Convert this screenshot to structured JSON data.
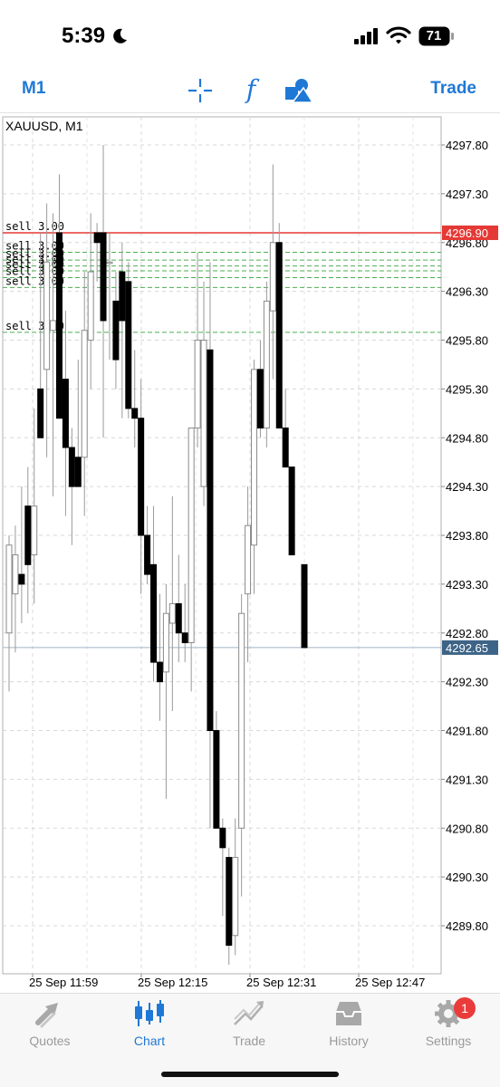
{
  "status_bar": {
    "time": "5:39",
    "battery": "71",
    "icons": [
      "moon-icon",
      "signal-icon",
      "wifi-icon",
      "battery-icon"
    ]
  },
  "toolbar": {
    "period_label": "M1",
    "trade_label": "Trade",
    "icons": [
      "crosshair-icon",
      "function-icon",
      "objects-icon"
    ],
    "function_glyph": "f",
    "accent_color": "#1f78d6"
  },
  "chart": {
    "symbol_label": "XAUUSD, M1",
    "price_labels": [
      "4297.80",
      "4297.30",
      "4296.80",
      "4296.30",
      "4295.80",
      "4295.30",
      "4294.80",
      "4294.30",
      "4293.80",
      "4293.30",
      "4292.80",
      "4292.30",
      "4291.80",
      "4291.30",
      "4290.80",
      "4290.30",
      "4289.80"
    ],
    "time_labels": [
      "25 Sep 11:59",
      "25 Sep 12:15",
      "25 Sep 12:31",
      "25 Sep 12:47"
    ],
    "sell_price_tag": "4296.90",
    "bid_price_tag": "4292.65",
    "sell_line_color": "#e53935",
    "bid_line_color": "#3d6487",
    "order_lines": [
      {
        "label": "sell 3.00",
        "price": 4296.9
      },
      {
        "label": "sell 3.00",
        "price": 4296.7
      },
      {
        "label": "sell 3.00",
        "price": 4296.62
      },
      {
        "label": "sell 3.00",
        "price": 4296.56
      },
      {
        "label": "sell 3.00",
        "price": 4296.51
      },
      {
        "label": "sell 3.00",
        "price": 4296.44
      },
      {
        "label": "sell 3.00",
        "price": 4296.34
      },
      {
        "label": "sell 3.00",
        "price": 4295.88
      }
    ]
  },
  "chart_data": {
    "type": "candlestick",
    "title": "XAUUSD, M1",
    "ylim": [
      4289.4,
      4298.2
    ],
    "grid": true,
    "candles": [
      {
        "o": 4292.8,
        "h": 4293.8,
        "l": 4292.2,
        "c": 4293.7
      },
      {
        "o": 4293.2,
        "h": 4293.9,
        "l": 4292.6,
        "c": 4293.6
      },
      {
        "o": 4293.4,
        "h": 4294.3,
        "l": 4292.9,
        "c": 4293.3
      },
      {
        "o": 4294.1,
        "h": 4294.5,
        "l": 4293.0,
        "c": 4293.5
      },
      {
        "o": 4293.6,
        "h": 4295.1,
        "l": 4293.1,
        "c": 4294.1
      },
      {
        "o": 4295.3,
        "h": 4296.9,
        "l": 4294.9,
        "c": 4294.8
      },
      {
        "o": 4295.5,
        "h": 4297.2,
        "l": 4294.6,
        "c": 4296.6
      },
      {
        "o": 4295.9,
        "h": 4297.1,
        "l": 4294.2,
        "c": 4296.0
      },
      {
        "o": 4296.9,
        "h": 4297.5,
        "l": 4295.0,
        "c": 4295.0
      },
      {
        "o": 4295.4,
        "h": 4296.1,
        "l": 4294.0,
        "c": 4294.7
      },
      {
        "o": 4294.7,
        "h": 4294.9,
        "l": 4293.7,
        "c": 4294.3
      },
      {
        "o": 4294.6,
        "h": 4295.6,
        "l": 4294.3,
        "c": 4294.3
      },
      {
        "o": 4294.6,
        "h": 4296.5,
        "l": 4294.0,
        "c": 4295.9
      },
      {
        "o": 4295.8,
        "h": 4297.1,
        "l": 4295.3,
        "c": 4296.5
      },
      {
        "o": 4296.9,
        "h": 4297.0,
        "l": 4296.4,
        "c": 4296.8
      },
      {
        "o": 4296.9,
        "h": 4297.8,
        "l": 4294.8,
        "c": 4296.0
      },
      {
        "o": 4296.6,
        "h": 4296.9,
        "l": 4295.6,
        "c": 4296.6
      },
      {
        "o": 4296.2,
        "h": 4296.5,
        "l": 4295.3,
        "c": 4295.6
      },
      {
        "o": 4296.5,
        "h": 4296.8,
        "l": 4295.0,
        "c": 4296.0
      },
      {
        "o": 4296.4,
        "h": 4296.6,
        "l": 4295.0,
        "c": 4295.1
      },
      {
        "o": 4295.1,
        "h": 4295.7,
        "l": 4294.7,
        "c": 4295.0
      },
      {
        "o": 4295.0,
        "h": 4295.4,
        "l": 4293.2,
        "c": 4293.8
      },
      {
        "o": 4293.8,
        "h": 4294.1,
        "l": 4293.3,
        "c": 4293.4
      },
      {
        "o": 4293.5,
        "h": 4294.1,
        "l": 4292.3,
        "c": 4292.5
      },
      {
        "o": 4292.5,
        "h": 4293.2,
        "l": 4291.9,
        "c": 4292.3
      },
      {
        "o": 4292.4,
        "h": 4293.3,
        "l": 4291.1,
        "c": 4293.0
      },
      {
        "o": 4292.9,
        "h": 4294.2,
        "l": 4292.0,
        "c": 4293.1
      },
      {
        "o": 4293.1,
        "h": 4293.6,
        "l": 4292.5,
        "c": 4292.8
      },
      {
        "o": 4292.8,
        "h": 4293.3,
        "l": 4292.5,
        "c": 4292.7
      },
      {
        "o": 4292.7,
        "h": 4294.7,
        "l": 4292.2,
        "c": 4294.9
      },
      {
        "o": 4294.9,
        "h": 4296.7,
        "l": 4294.7,
        "c": 4295.8
      },
      {
        "o": 4294.3,
        "h": 4296.4,
        "l": 4294.1,
        "c": 4295.8
      },
      {
        "o": 4295.7,
        "h": 4296.6,
        "l": 4290.8,
        "c": 4291.8
      },
      {
        "o": 4291.8,
        "h": 4292.0,
        "l": 4290.8,
        "c": 4290.8
      },
      {
        "o": 4290.8,
        "h": 4290.9,
        "l": 4289.9,
        "c": 4290.6
      },
      {
        "o": 4290.5,
        "h": 4290.6,
        "l": 4289.4,
        "c": 4289.6
      },
      {
        "o": 4289.7,
        "h": 4290.9,
        "l": 4289.5,
        "c": 4290.5
      },
      {
        "o": 4290.8,
        "h": 4293.2,
        "l": 4290.1,
        "c": 4293.0
      },
      {
        "o": 4293.2,
        "h": 4294.3,
        "l": 4292.5,
        "c": 4293.9
      },
      {
        "o": 4293.7,
        "h": 4295.6,
        "l": 4293.2,
        "c": 4295.5
      },
      {
        "o": 4295.5,
        "h": 4295.8,
        "l": 4294.8,
        "c": 4294.9
      },
      {
        "o": 4294.9,
        "h": 4296.4,
        "l": 4294.7,
        "c": 4296.2
      },
      {
        "o": 4296.1,
        "h": 4297.6,
        "l": 4295.4,
        "c": 4296.8
      },
      {
        "o": 4296.8,
        "h": 4297.0,
        "l": 4294.9,
        "c": 4294.9
      },
      {
        "o": 4294.9,
        "h": 4295.3,
        "l": 4294.5,
        "c": 4294.5
      },
      {
        "o": 4294.5,
        "h": 4294.5,
        "l": 4293.6,
        "c": 4293.6
      },
      null,
      {
        "o": 4293.5,
        "h": 4293.5,
        "l": 4292.65,
        "c": 4292.65
      }
    ]
  },
  "tabs": [
    {
      "label": "Quotes",
      "icon": "quotes-icon",
      "active": false
    },
    {
      "label": "Chart",
      "icon": "chart-icon",
      "active": true
    },
    {
      "label": "Trade",
      "icon": "trade-icon",
      "active": false
    },
    {
      "label": "History",
      "icon": "history-icon",
      "active": false
    },
    {
      "label": "Settings",
      "icon": "settings-icon",
      "active": false,
      "badge": "1"
    }
  ]
}
